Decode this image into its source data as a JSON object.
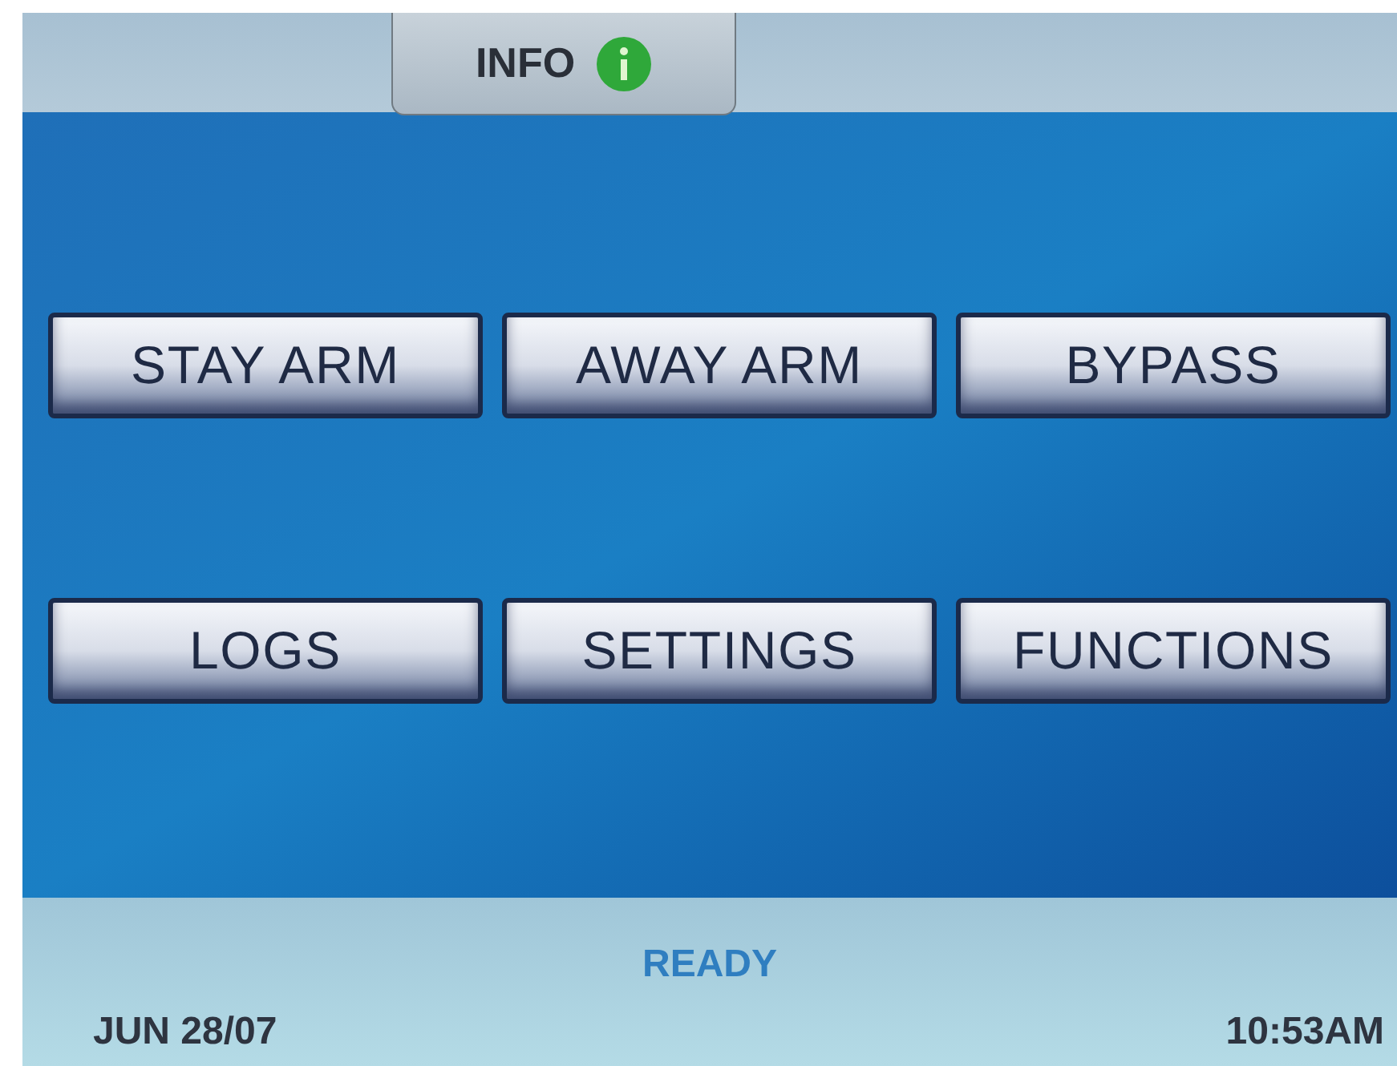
{
  "info_tab": {
    "label": "INFO"
  },
  "buttons": [
    {
      "label": "STAY ARM"
    },
    {
      "label": "AWAY ARM"
    },
    {
      "label": "BYPASS"
    },
    {
      "label": "LOGS"
    },
    {
      "label": "SETTINGS"
    },
    {
      "label": "FUNCTIONS"
    }
  ],
  "status_bar": {
    "status": "READY",
    "date": "JUN 28/07",
    "time": "10:53AM"
  }
}
